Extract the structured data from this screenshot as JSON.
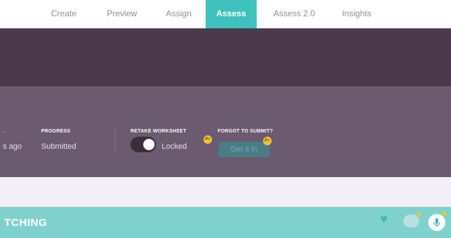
{
  "nav": {
    "tabs": [
      {
        "label": "Create",
        "active": false
      },
      {
        "label": "Preview",
        "active": false
      },
      {
        "label": "Assign",
        "active": false
      },
      {
        "label": "Assess",
        "active": true
      },
      {
        "label": "Assess 2.0",
        "active": false
      },
      {
        "label": "Insights",
        "active": false
      }
    ]
  },
  "stats": {
    "first_value": "s ago",
    "progress_label": "PROGRESS",
    "progress_value": "Submitted",
    "retake_label": "RETAKE WORKSHEET",
    "retake_value": "Locked",
    "retake_locked": true,
    "forgot_label": "FORGOT TO SUBMIT?",
    "get_it_in_label": "Get it in",
    "pro_badge": "P+"
  },
  "bottom_bar": {
    "title": "TCHING"
  },
  "icons": {
    "heart": "heart-icon",
    "mic": "microphone-icon"
  },
  "colors": {
    "accent": "#3fc2be",
    "dark_band": "#4a3a4c",
    "panel": "#6b5a70",
    "bottom_bar": "#7fd1cd",
    "badge": "#f3c23a"
  }
}
